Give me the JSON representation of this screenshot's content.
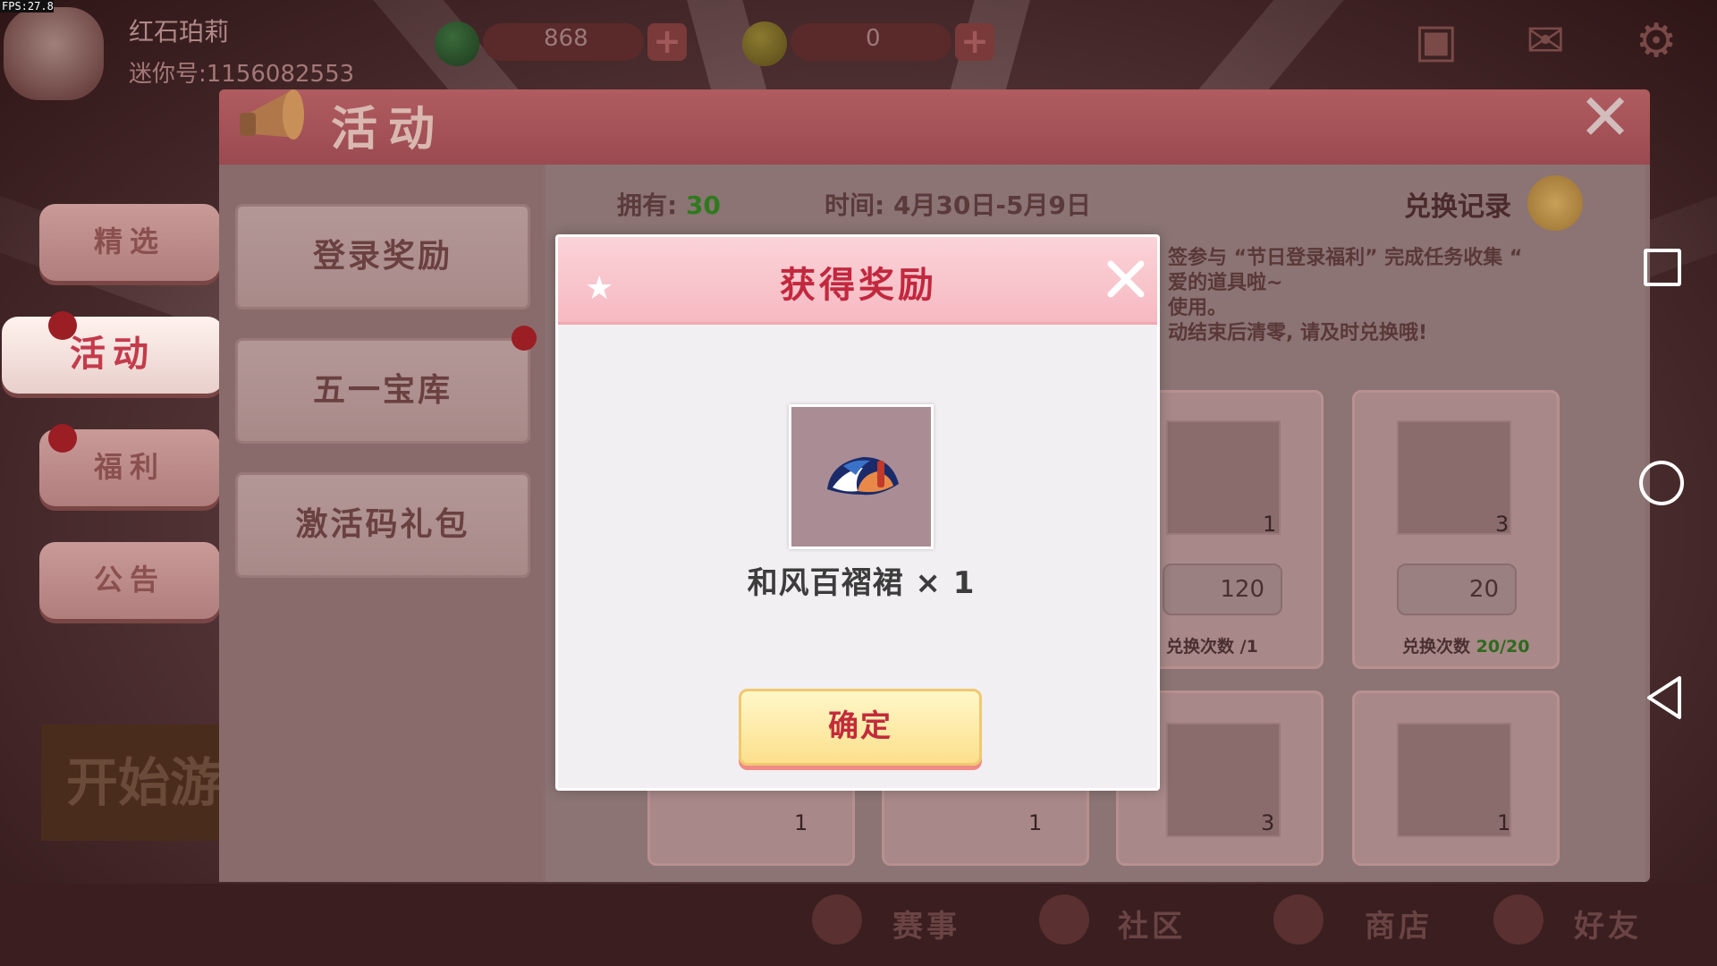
{
  "fps": "FPS:27.8",
  "player": {
    "name": "红石珀莉",
    "id": "迷你号:1156082553"
  },
  "currency": {
    "gems": "868",
    "coins": "0"
  },
  "side_tabs": [
    {
      "label": "精选"
    },
    {
      "label": "活动"
    },
    {
      "label": "福利"
    },
    {
      "label": "公告"
    }
  ],
  "start_game": "开始游",
  "panel": {
    "title": "活动",
    "menu": [
      "登录奖励",
      "五一宝库",
      "激活码礼包"
    ],
    "own_label": "拥有:",
    "own_value": "30",
    "time_label": "时间: 4月30日-5月9日",
    "exchange_record": "兑换记录",
    "desc_lines": [
      "签参与 “节日登录福利” 完成任务收集 “",
      "爱的道具啦~",
      "使用。",
      "动结束后清零, 请及时兑换哦!"
    ],
    "cards_top": [
      {
        "qty": "1",
        "cost": "120",
        "exch_label": "兑换次数",
        "exch_value": "/1"
      },
      {
        "qty": "3",
        "cost": "20",
        "exch_label": "兑换次数",
        "exch_value": "20/20"
      }
    ],
    "cards_bottom": [
      {
        "qty": "1"
      },
      {
        "qty": "1"
      },
      {
        "qty": "3"
      },
      {
        "qty": "1"
      }
    ]
  },
  "bottom_nav": [
    "赛事",
    "社区",
    "商店",
    "好友"
  ],
  "modal": {
    "title": "获得奖励",
    "reward_name": "和风百褶裙 × 1",
    "confirm": "确定"
  },
  "colors": {
    "accent": "#c2283e",
    "own_value": "#2f7a1e",
    "confirm_bg": "#fbe08c"
  }
}
